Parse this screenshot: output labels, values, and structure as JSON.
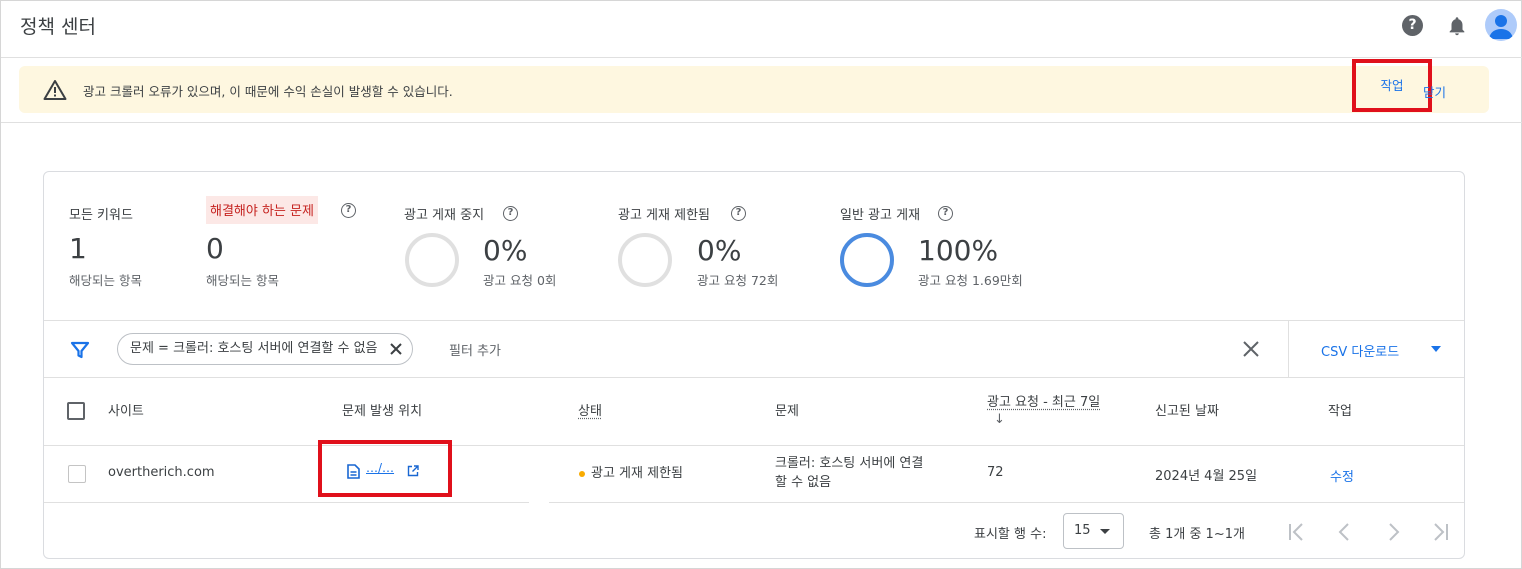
{
  "header": {
    "title": "정책 센터",
    "help_icon_glyph": "?"
  },
  "banner": {
    "message": "광고 크롤러 오류가 있으며, 이 때문에 수익 손실이 발생할 수 있습니다.",
    "action_label": "작업",
    "close_label": "닫기"
  },
  "stats": {
    "all_keywords": {
      "label": "모든 키워드",
      "value": "1",
      "sub": "해당되는 항목"
    },
    "issues": {
      "label": "해결해야 하는 문제",
      "value": "0",
      "sub": "해당되는 항목"
    },
    "paused": {
      "label": "광고 게재 중지",
      "value": "0%",
      "sub": "광고 요청 0회",
      "fraction": 0
    },
    "limited": {
      "label": "광고 게재 제한됨",
      "value": "0%",
      "sub": "광고 요청 72회",
      "fraction": 0
    },
    "normal": {
      "label": "일반 광고 게재",
      "value": "100%",
      "sub": "광고 요청 1.69만회",
      "fraction": 1
    }
  },
  "filter": {
    "chip_label": "문제 = 크롤러: 호스팅 서버에 연결할 수 없음",
    "add_filter": "필터 추가",
    "csv_label": "CSV 다운로드"
  },
  "table": {
    "columns": [
      "사이트",
      "문제 발생 위치",
      "상태",
      "문제",
      "광고 요청 - 최근 7일",
      "신고된 날짜",
      "작업"
    ],
    "sort_arrow": "↓",
    "rows": [
      {
        "site": "overtherich.com",
        "location": "…/…",
        "status": "광고 게재 제한됨",
        "issue_line1": "크롤러: 호스팅 서버에 연결",
        "issue_line2": "할 수 없음",
        "requests": "72",
        "date": "2024년 4월 25일",
        "action": "수정"
      }
    ]
  },
  "footer": {
    "rows_label": "표시할 행 수:",
    "rows_value": "15",
    "range_text": "총 1개 중 1~1개"
  },
  "colors": {
    "accent": "#1a73e8",
    "ring_empty": "#e0e0e0",
    "ring_full": "#4a8be0",
    "highlight_box": "#e0101b",
    "status_limited": "#f9ab00"
  }
}
